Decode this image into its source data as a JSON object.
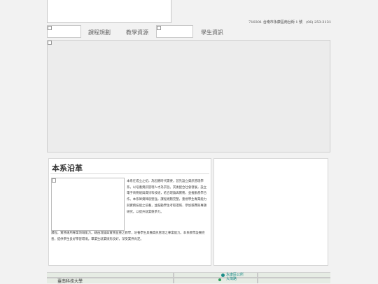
{
  "header": {
    "address": "710301 台南市永康區南台街 1 號　(06) 253-3131"
  },
  "nav": {
    "items": [
      {
        "label": "課程規劃"
      },
      {
        "label": "教學資源"
      },
      {
        "label": "學生資訊"
      }
    ]
  },
  "history": {
    "title": "本系沿革",
    "paragraph_right": "本系在成立之初，為因應時代需要，首先設立資訊管理學系，以培養資訊管理人才為宗旨。其後配合社會發展，設立電子商務組與資訊科技組，結合理論與實務，並推動產學合作。本系師資陣容堅強，課程規劃完整，重視學生專業能力與實務技能之培養，並鼓勵學生考取證照、參加競賽與專題研究，以提升就業競爭力。",
    "paragraph_full": "課程，實務運用專業領域能力。藉由理論與實務並重之教學，培養學生具備資訊管理之專業能力。本系教學設備完善，提供學生良好學習環境。畢業生就業情形良好，深受業界肯定。"
  },
  "map": {
    "label_left": "臺南科技大學",
    "label_mid_line1": "永康區公所",
    "label_mid_line2": "大灣路"
  }
}
